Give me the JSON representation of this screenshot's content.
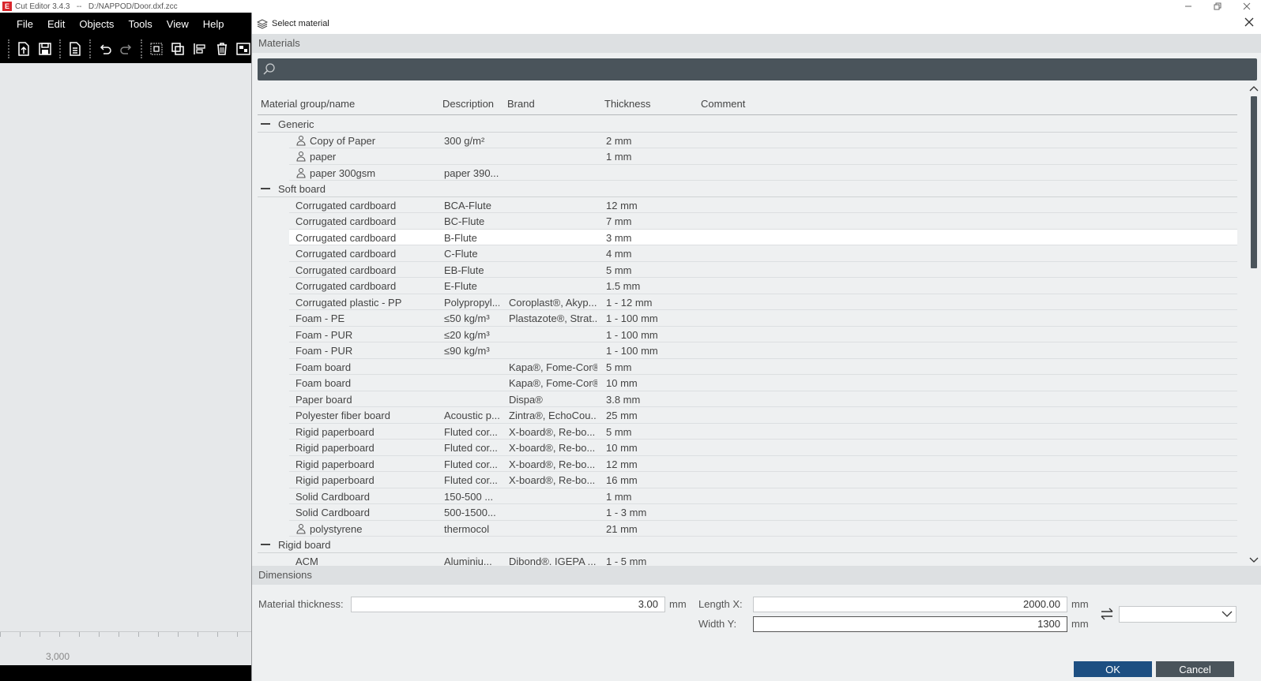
{
  "app": {
    "logo": "E",
    "title": "Cut Editor 3.4.3   --   D:/NAPPOD/Door.dxf.zcc",
    "menu": [
      "File",
      "Edit",
      "Objects",
      "Tools",
      "View",
      "Help"
    ],
    "toolbar_icons": [
      "import-icon",
      "save-icon",
      "export-icon",
      "undo-icon",
      "redo-icon",
      "group-icon",
      "transform-icon",
      "align-icon",
      "delete-icon",
      "nest-icon"
    ],
    "ruler_label": "3,000"
  },
  "dialog": {
    "title": "Select material",
    "materials_header": "Materials",
    "search": {
      "value": "",
      "placeholder": ""
    },
    "columns": [
      "Material group/name",
      "Description",
      "Brand",
      "Thickness",
      "Comment"
    ],
    "groups": [
      {
        "name": "Generic",
        "rows": [
          {
            "name": "Copy of Paper",
            "description": "300 g/m²",
            "brand": "",
            "thickness": "2 mm",
            "comment": "",
            "user": true
          },
          {
            "name": "paper",
            "description": "",
            "brand": "",
            "thickness": "1 mm",
            "comment": "",
            "user": true
          },
          {
            "name": "paper 300gsm",
            "description": "paper 390...",
            "brand": "",
            "thickness": "",
            "comment": "",
            "user": true
          }
        ]
      },
      {
        "name": "Soft board",
        "rows": [
          {
            "name": "Corrugated cardboard",
            "description": "BCA-Flute",
            "brand": "",
            "thickness": "12 mm",
            "comment": ""
          },
          {
            "name": "Corrugated cardboard",
            "description": "BC-Flute",
            "brand": "",
            "thickness": "7 mm",
            "comment": ""
          },
          {
            "name": "Corrugated cardboard",
            "description": "B-Flute",
            "brand": "",
            "thickness": "3 mm",
            "comment": "",
            "selected": true
          },
          {
            "name": "Corrugated cardboard",
            "description": "C-Flute",
            "brand": "",
            "thickness": "4 mm",
            "comment": ""
          },
          {
            "name": "Corrugated cardboard",
            "description": "EB-Flute",
            "brand": "",
            "thickness": "5 mm",
            "comment": ""
          },
          {
            "name": "Corrugated cardboard",
            "description": "E-Flute",
            "brand": "",
            "thickness": "1.5 mm",
            "comment": ""
          },
          {
            "name": "Corrugated plastic - PP",
            "description": "Polypropyl...",
            "brand": "Coroplast®, Akyp...",
            "thickness": "1 - 12 mm",
            "comment": ""
          },
          {
            "name": "Foam  - PE",
            "description": "≤50 kg/m³",
            "brand": "Plastazote®, Strat...",
            "thickness": "1 - 100 mm",
            "comment": ""
          },
          {
            "name": "Foam - PUR",
            "description": "≤20 kg/m³",
            "brand": "",
            "thickness": "1 - 100 mm",
            "comment": ""
          },
          {
            "name": "Foam - PUR",
            "description": "≤90 kg/m³",
            "brand": "",
            "thickness": "1 - 100 mm",
            "comment": ""
          },
          {
            "name": "Foam board",
            "description": "",
            "brand": "Kapa®, Fome-Cor®",
            "thickness": "5 mm",
            "comment": ""
          },
          {
            "name": "Foam board",
            "description": "",
            "brand": "Kapa®, Fome-Cor®",
            "thickness": "10 mm",
            "comment": ""
          },
          {
            "name": "Paper board",
            "description": "",
            "brand": "Dispa®",
            "thickness": "3.8 mm",
            "comment": ""
          },
          {
            "name": "Polyester fiber board",
            "description": "Acoustic p...",
            "brand": "Zintra®, EchoCou...",
            "thickness": "25 mm",
            "comment": ""
          },
          {
            "name": "Rigid paperboard",
            "description": "Fluted cor...",
            "brand": "X-board®, Re-bo...",
            "thickness": "5 mm",
            "comment": ""
          },
          {
            "name": "Rigid paperboard",
            "description": "Fluted cor...",
            "brand": "X-board®, Re-bo...",
            "thickness": "10 mm",
            "comment": ""
          },
          {
            "name": "Rigid paperboard",
            "description": "Fluted cor...",
            "brand": "X-board®, Re-bo...",
            "thickness": "12 mm",
            "comment": ""
          },
          {
            "name": "Rigid paperboard",
            "description": "Fluted cor...",
            "brand": "X-board®, Re-bo...",
            "thickness": "16 mm",
            "comment": ""
          },
          {
            "name": "Solid Cardboard",
            "description": "150-500 ...",
            "brand": "",
            "thickness": "1 mm",
            "comment": ""
          },
          {
            "name": "Solid Cardboard",
            "description": "500-1500...",
            "brand": "",
            "thickness": "1 - 3 mm",
            "comment": ""
          },
          {
            "name": "polystyrene",
            "description": "thermocol",
            "brand": "",
            "thickness": "21 mm",
            "comment": "",
            "user": true
          }
        ]
      },
      {
        "name": "Rigid board",
        "rows": [
          {
            "name": "ACM",
            "description": "Aluminiu...",
            "brand": "Dibond®, IGEPA ...",
            "thickness": "1 - 5 mm",
            "comment": ""
          }
        ]
      }
    ],
    "dimensions_header": "Dimensions",
    "dimensions": {
      "thickness_label": "Material thickness:",
      "thickness_value": "3.00",
      "length_label": "Length X:",
      "length_value": "2000.00",
      "width_label": "Width Y:",
      "width_value": "1300",
      "unit": "mm",
      "preset_value": ""
    },
    "ok_label": "OK",
    "cancel_label": "Cancel"
  }
}
